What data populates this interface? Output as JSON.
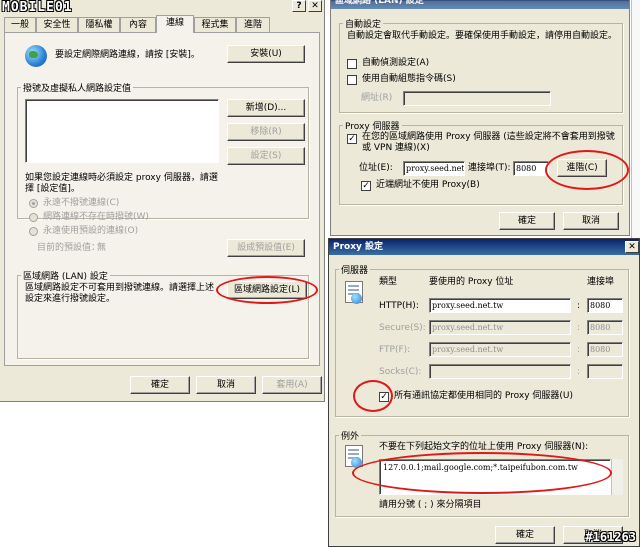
{
  "watermark_logo": "MOBILE01",
  "watermark_id": "#161263",
  "inet": {
    "tabs": [
      "一般",
      "安全性",
      "隱私權",
      "內容",
      "連線",
      "程式集",
      "進階"
    ],
    "setup_text": "要設定網際網路連線，請按 [安裝]。",
    "setup_button": "安裝(U)",
    "dialup_group": "撥號及虛擬私人網路設定值",
    "add_button": "新增(D)...",
    "remove_button": "移除(R)",
    "settings_button": "設定(S)",
    "proxy_hint": "如果您設定連線時必須設定 proxy 伺服器，請選擇 [設定值]。",
    "radios": [
      "永遠不撥號連線(C)",
      "網路連線不存在時撥號(W)",
      "永遠使用預設的連線(O)"
    ],
    "current_default": "目前的預設值：",
    "current_default_value": "無",
    "set_default_button": "設成預設值(E)",
    "lan_group": "區域網路 (LAN) 設定",
    "lan_text": "區域網路設定不可套用到撥號連線。請選擇上述設定來進行撥號設定。",
    "lan_button": "區域網路設定(L)",
    "ok": "確定",
    "cancel": "取消",
    "apply": "套用(A)"
  },
  "lan": {
    "title": "區域網路 (LAN) 設定",
    "auto_group": "自動設定",
    "auto_text": "自動設定會取代手動設定。要確保使用手動設定，請停用自動設定。",
    "auto_detect": "自動偵測設定(A)",
    "auto_script": "使用自動組態指令碼(S)",
    "address_label": "網址(R)",
    "proxy_group": "Proxy 伺服器",
    "use_proxy": "在您的區域網路使用 Proxy 伺服器 (這些設定將不會套用到撥號或 VPN 連線)(X)",
    "addr_label": "位址(E):",
    "addr_value": "proxy.seed.net",
    "port_label": "連接埠(T):",
    "port_value": "8080",
    "advanced_button": "進階(C)",
    "bypass_local": "近端網址不使用 Proxy(B)",
    "ok": "確定",
    "cancel": "取消"
  },
  "proxy": {
    "title": "Proxy 設定",
    "servers_group": "伺服器",
    "col_type": "類型",
    "col_addr": "要使用的 Proxy 位址",
    "col_port": "連接埠",
    "rows": [
      {
        "label": "HTTP(H):",
        "addr": "proxy.seed.net.tw",
        "port": "8080"
      },
      {
        "label": "Secure(S):",
        "addr": "proxy.seed.net.tw",
        "port": "8080"
      },
      {
        "label": "FTP(F):",
        "addr": "proxy.seed.net.tw",
        "port": "8080"
      },
      {
        "label": "Socks(C):",
        "addr": "",
        "port": ""
      }
    ],
    "same_for_all": "所有通訊協定都使用相同的 Proxy 伺服器(U)",
    "exceptions_group": "例外",
    "exceptions_text": "不要在下列起始文字的位址上使用 Proxy 伺服器(N):",
    "exceptions_value": "127.0.0.1;mail.google.com;*.taipeifubon.com.tw",
    "separator_hint": "請用分號 ( ; ) 來分隔項目",
    "ok": "確定",
    "cancel": "取消"
  }
}
